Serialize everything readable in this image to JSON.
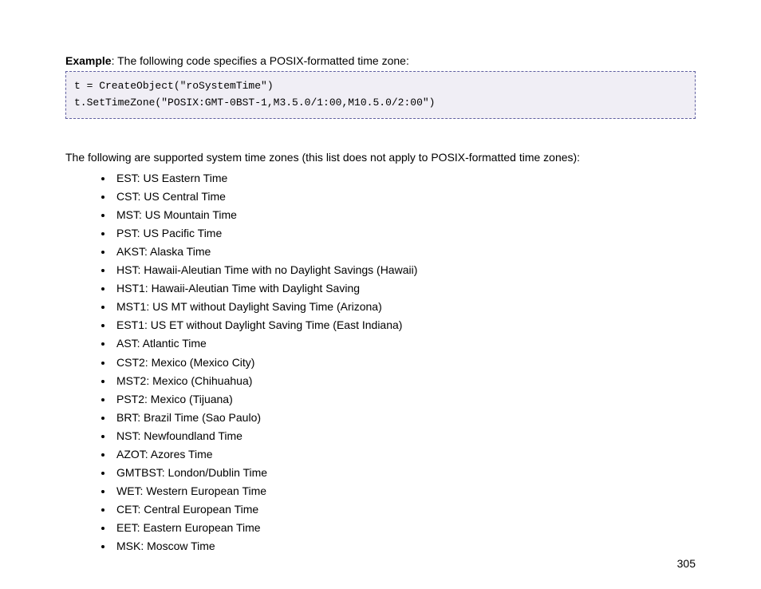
{
  "example": {
    "label": "Example",
    "description": ": The following code specifies a POSIX-formatted time zone:"
  },
  "code": {
    "line1": "t = CreateObject(\"roSystemTime\")",
    "line2": "t.SetTimeZone(\"POSIX:GMT-0BST-1,M3.5.0/1:00,M10.5.0/2:00\")"
  },
  "intro": "The following are supported system time zones (this list does not apply to POSIX-formatted time zones):",
  "timezones": [
    "EST: US Eastern Time",
    "CST: US Central Time",
    "MST: US Mountain Time",
    "PST: US Pacific Time",
    "AKST: Alaska Time",
    "HST: Hawaii-Aleutian Time with no Daylight Savings (Hawaii)",
    "HST1: Hawaii-Aleutian Time with Daylight Saving",
    "MST1: US MT without Daylight Saving Time (Arizona)",
    "EST1: US ET without Daylight Saving Time (East Indiana)",
    "AST: Atlantic Time",
    "CST2: Mexico (Mexico City)",
    "MST2: Mexico (Chihuahua)",
    "PST2: Mexico (Tijuana)",
    "BRT: Brazil Time (Sao Paulo)",
    "NST: Newfoundland Time",
    "AZOT: Azores Time",
    "GMTBST: London/Dublin Time",
    "WET: Western European Time",
    "CET: Central European Time",
    "EET: Eastern European Time",
    "MSK: Moscow Time"
  ],
  "pageNumber": "305"
}
